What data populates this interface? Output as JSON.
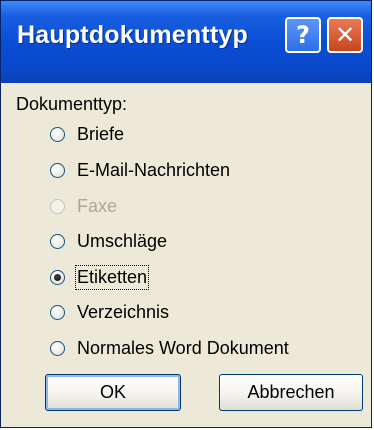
{
  "window": {
    "title": "Hauptdokumenttyp",
    "help_button": "?",
    "close_button": "✕"
  },
  "group": {
    "label": "Dokumenttyp:"
  },
  "options": [
    {
      "label": "Briefe",
      "selected": false,
      "disabled": false
    },
    {
      "label": "E-Mail-Nachrichten",
      "selected": false,
      "disabled": false
    },
    {
      "label": "Faxe",
      "selected": false,
      "disabled": true
    },
    {
      "label": "Umschläge",
      "selected": false,
      "disabled": false
    },
    {
      "label": "Etiketten",
      "selected": true,
      "disabled": false
    },
    {
      "label": "Verzeichnis",
      "selected": false,
      "disabled": false
    },
    {
      "label": "Normales Word Dokument",
      "selected": false,
      "disabled": false
    }
  ],
  "buttons": {
    "ok": "OK",
    "cancel": "Abbrechen"
  }
}
